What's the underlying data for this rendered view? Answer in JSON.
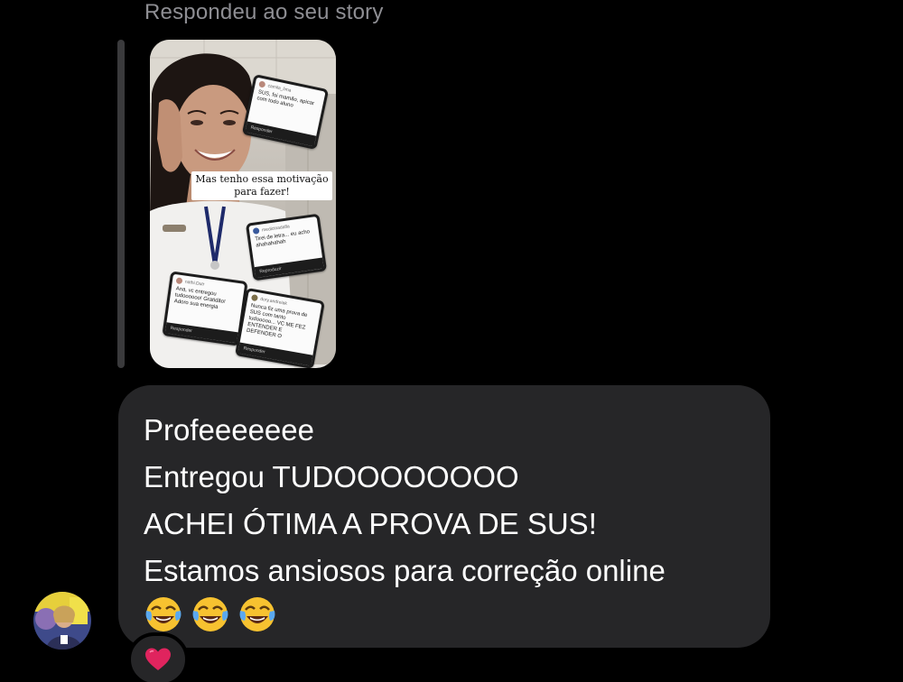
{
  "thread": {
    "reply_label": "Respondeu ao seu story"
  },
  "story": {
    "caption": "Mas tenho essa motivação para fazer!",
    "cards": [
      {
        "user": "camila_lima",
        "text": "SUS, foi mamão, apicar com todo aluno",
        "footer": "Responder"
      },
      {
        "user": "medicinadafla",
        "text": "Tirei de letra... eu acho ahahahahah",
        "footer": "Reproduzir"
      },
      {
        "user": "nathi.Dutr",
        "text": "Ana, vc entregou tudoooooo! Gratidão! Adoro sua energia",
        "footer": "Responder"
      },
      {
        "user": "dory.andreiak",
        "text": "Nunca fiz uma prova de SUS com tanto tudooooo... VC ME FEZ ENTENDER E DEFENDER O",
        "footer": "Responder"
      }
    ]
  },
  "message": {
    "lines": [
      "Profeeeeeee",
      "Entregou TUDOOOOOOOO",
      "ACHEI ÓTIMA A PROVA DE SUS!",
      "Estamos ansiosos para correção online"
    ],
    "emojis": [
      "face-with-tears-of-joy",
      "face-with-tears-of-joy",
      "face-with-tears-of-joy"
    ]
  },
  "reaction": {
    "icon": "red-heart",
    "color": "#e0245e"
  },
  "colors": {
    "background": "#000000",
    "bubble": "#262628",
    "muted_text": "#8e8e93",
    "text": "#ffffff"
  }
}
